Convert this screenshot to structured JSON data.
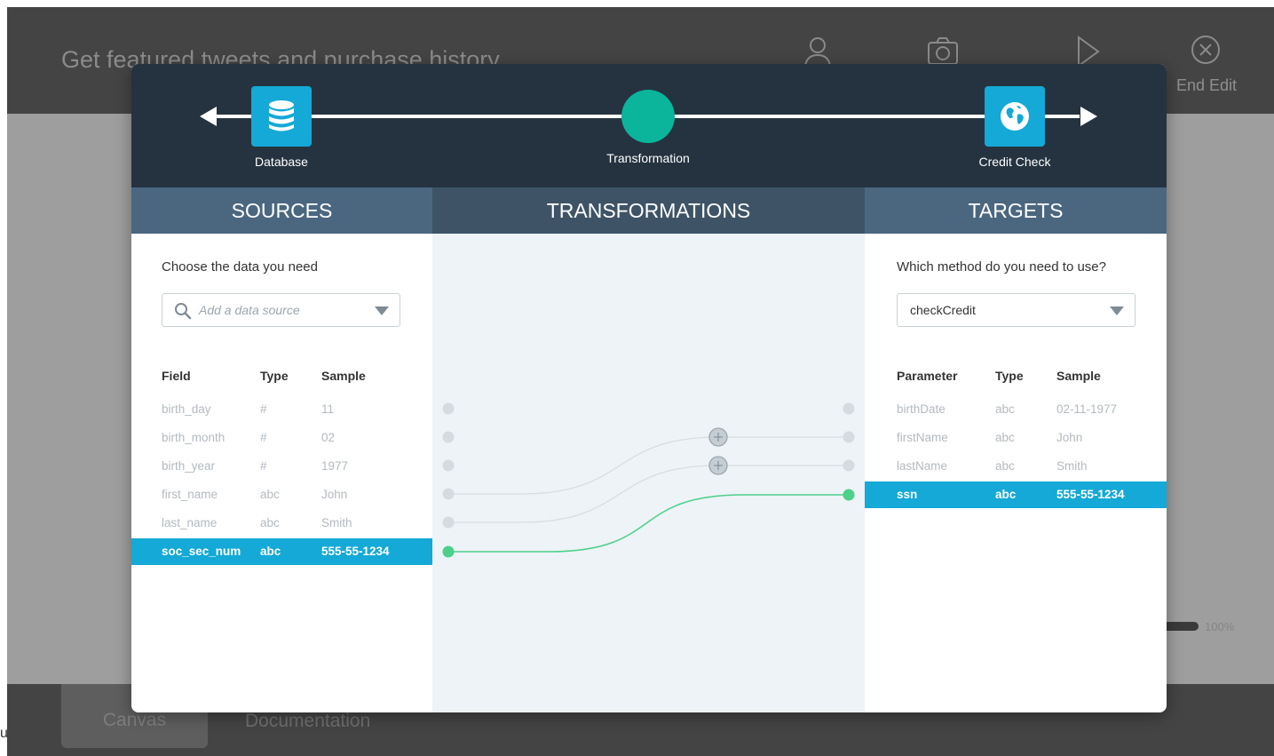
{
  "app": {
    "title": "Get featured tweets and purchase history",
    "end_edit_label": "End Edit",
    "progress_label": "100%",
    "progress_value": 1.0,
    "tabs": [
      "Canvas",
      "Documentation"
    ],
    "left_crumb": "u"
  },
  "flow": {
    "source_node": "Database",
    "transform_node": "Transformation",
    "target_node": "Credit Check"
  },
  "columns": {
    "sources": "SOURCES",
    "transformations": "TRANSFORMATIONS",
    "targets": "TARGETS"
  },
  "sources": {
    "prompt": "Choose the data you need",
    "placeholder": "Add a data source",
    "headers": [
      "Field",
      "Type",
      "Sample"
    ],
    "rows": [
      {
        "field": "birth_day",
        "type": "#",
        "sample": "11"
      },
      {
        "field": "birth_month",
        "type": "#",
        "sample": "02"
      },
      {
        "field": "birth_year",
        "type": "#",
        "sample": "1977"
      },
      {
        "field": "first_name",
        "type": "abc",
        "sample": "John"
      },
      {
        "field": "last_name",
        "type": "abc",
        "sample": "Smith"
      },
      {
        "field": "soc_sec_num",
        "type": "abc",
        "sample": "555-55-1234"
      }
    ],
    "selected_index": 5
  },
  "targets": {
    "prompt": "Which method do you need to use?",
    "selected_method": "checkCredit",
    "headers": [
      "Parameter",
      "Type",
      "Sample"
    ],
    "rows": [
      {
        "field": "birthDate",
        "type": "abc",
        "sample": "02-11-1977"
      },
      {
        "field": "firstName",
        "type": "abc",
        "sample": "John"
      },
      {
        "field": "lastName",
        "type": "abc",
        "sample": "Smith"
      },
      {
        "field": "ssn",
        "type": "abc",
        "sample": "555-55-1234"
      }
    ],
    "selected_index": 3
  },
  "colors": {
    "accent": "#14a9d6",
    "teal": "#0ab59c",
    "link_active": "#4cd08a",
    "header_dark": "#253340"
  }
}
